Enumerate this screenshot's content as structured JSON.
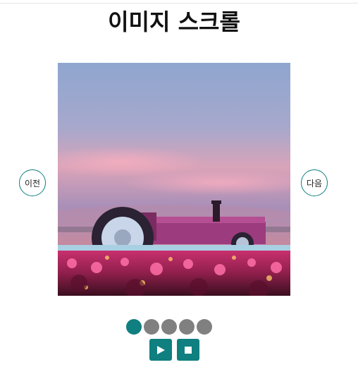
{
  "page": {
    "title": "이미지 스크롤"
  },
  "carousel": {
    "prev_label": "이전",
    "next_label": "다음",
    "slide_count": 5,
    "active_index": 0
  },
  "colors": {
    "accent": "#0f7f80",
    "inactive_dot": "#808080"
  },
  "icons": {
    "play": "play-icon",
    "stop": "stop-icon"
  }
}
